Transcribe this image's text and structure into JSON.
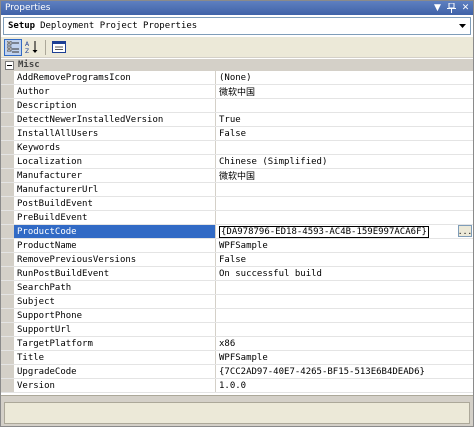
{
  "window": {
    "title": "Properties"
  },
  "object_selector": {
    "name": "Setup",
    "type": "Deployment Project Properties"
  },
  "toolbar": {
    "buttons": [
      {
        "icon": "categorized-icon",
        "active": true
      },
      {
        "icon": "alphabetical-icon",
        "active": false
      },
      {
        "icon": "property-pages-icon",
        "active": false
      }
    ]
  },
  "category": {
    "name": "Misc"
  },
  "properties": [
    {
      "name": "AddRemoveProgramsIcon",
      "value": "(None)"
    },
    {
      "name": "Author",
      "value": "微软中国"
    },
    {
      "name": "Description",
      "value": ""
    },
    {
      "name": "DetectNewerInstalledVersion",
      "value": "True"
    },
    {
      "name": "InstallAllUsers",
      "value": "False"
    },
    {
      "name": "Keywords",
      "value": ""
    },
    {
      "name": "Localization",
      "value": "Chinese (Simplified)"
    },
    {
      "name": "Manufacturer",
      "value": "微软中国"
    },
    {
      "name": "ManufacturerUrl",
      "value": ""
    },
    {
      "name": "PostBuildEvent",
      "value": ""
    },
    {
      "name": "PreBuildEvent",
      "value": ""
    },
    {
      "name": "ProductCode",
      "value": "{DA978796-ED18-4593-AC4B-159E997ACA6F}",
      "selected": true,
      "ellipsis": "..."
    },
    {
      "name": "ProductName",
      "value": "WPFSample"
    },
    {
      "name": "RemovePreviousVersions",
      "value": "False"
    },
    {
      "name": "RunPostBuildEvent",
      "value": "On successful build"
    },
    {
      "name": "SearchPath",
      "value": ""
    },
    {
      "name": "Subject",
      "value": ""
    },
    {
      "name": "SupportPhone",
      "value": ""
    },
    {
      "name": "SupportUrl",
      "value": ""
    },
    {
      "name": "TargetPlatform",
      "value": "x86"
    },
    {
      "name": "Title",
      "value": "WPFSample"
    },
    {
      "name": "UpgradeCode",
      "value": "{7CC2AD97-40E7-4265-BF15-513E6B4DEAD6}"
    },
    {
      "name": "Version",
      "value": "1.0.0"
    }
  ],
  "colors": {
    "titlebar": "#3f62a8",
    "selection": "#316ac5",
    "chrome": "#d4d0c8"
  }
}
